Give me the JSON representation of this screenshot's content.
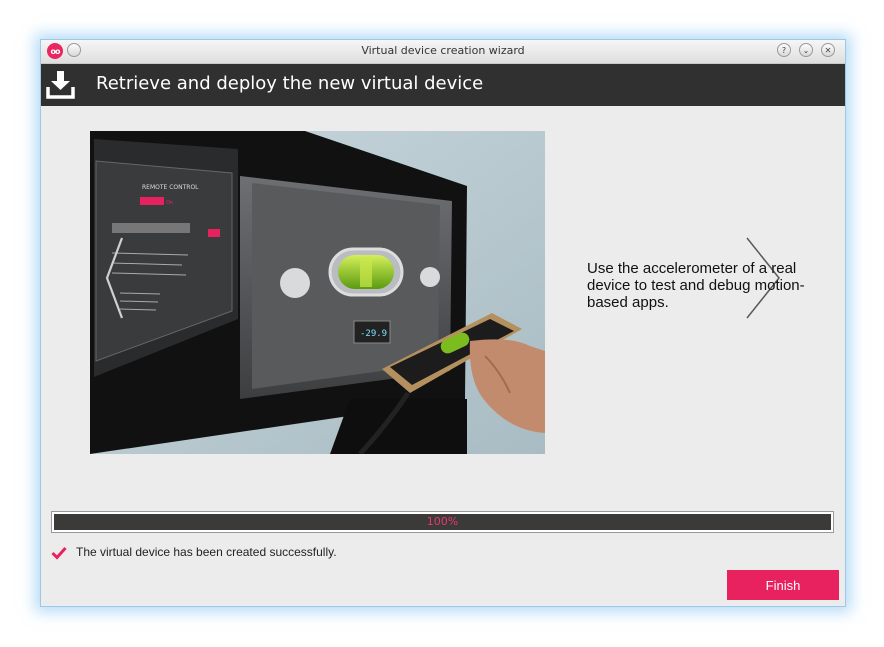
{
  "window": {
    "title": "Virtual device creation wizard",
    "logo_text": "oo",
    "buttons": [
      "help-icon",
      "minimize-icon",
      "close-icon"
    ]
  },
  "header": {
    "title": "Retrieve and deploy the new virtual device",
    "icon": "download-icon"
  },
  "carousel": {
    "caption": "Use the accelerometer of a real device to test and debug motion-based apps.",
    "image": "Photo of a tablet showing a remote control app and spirit level on a monitor, held next to a real phone",
    "screen_panel_title": "REMOTE CONTROL",
    "screen_panel_toggle": "On",
    "prev_icon": "chevron-left-icon",
    "next_icon": "chevron-right-icon"
  },
  "progress": {
    "value": 1.0,
    "label": "100%"
  },
  "status": {
    "icon": "checkmark-icon",
    "text": "The virtual device has been created successfully."
  },
  "actions": {
    "finish_label": "Finish"
  },
  "colors": {
    "accent": "#e8215f",
    "header_bg": "#303030",
    "progress_bg": "#3b3a37",
    "window_bg": "#ececec"
  }
}
